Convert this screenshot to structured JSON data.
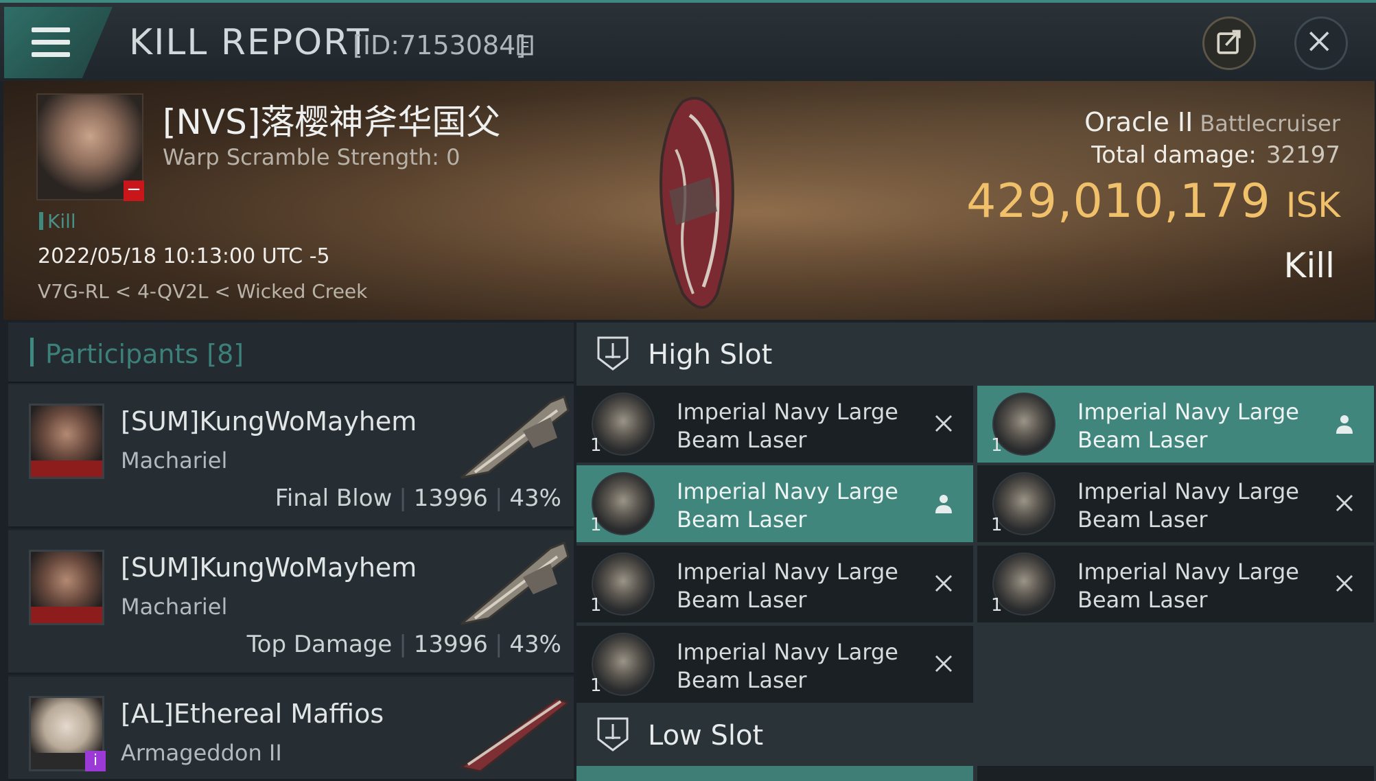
{
  "header": {
    "title": "KILL REPORT",
    "report_id": "[ID:7153084]"
  },
  "victim": {
    "name": "[NVS]落樱神斧华国父",
    "warp_scramble": "Warp Scramble Strength: 0",
    "tag": "Kill",
    "datetime": "2022/05/18 10:13:00 UTC -5",
    "location": "V7G-RL < 4-QV2L < Wicked Creek",
    "ship_name": "Oracle II",
    "ship_class": "Battlecruiser",
    "total_damage_label": "Total damage:",
    "total_damage": "32197",
    "isk_value": "429,010,179",
    "isk_unit": "ISK",
    "result": "Kill"
  },
  "participants": {
    "title": "Participants [8]",
    "items": [
      {
        "name": "[SUM]KungWoMayhem",
        "ship": "Machariel",
        "role": "Final Blow",
        "damage": "13996",
        "percent": "43%"
      },
      {
        "name": "[SUM]KungWoMayhem",
        "ship": "Machariel",
        "role": "Top Damage",
        "damage": "13996",
        "percent": "43%"
      },
      {
        "name": "[AL]Ethereal Maffios",
        "ship": "Armageddon II",
        "role": "",
        "damage": "",
        "percent": ""
      }
    ]
  },
  "slots": {
    "high_title": "High Slot",
    "low_title": "Low Slot",
    "high_modules": [
      {
        "name": "Imperial Navy Large Beam Laser",
        "qty": "1",
        "state": "destroyed",
        "icon": "close-icon"
      },
      {
        "name": "Imperial Navy Large Beam Laser",
        "qty": "1",
        "state": "dropped",
        "icon": "person-icon"
      },
      {
        "name": "Imperial Navy Large Beam Laser",
        "qty": "1",
        "state": "dropped",
        "icon": "person-icon"
      },
      {
        "name": "Imperial Navy Large Beam Laser",
        "qty": "1",
        "state": "destroyed",
        "icon": "close-icon"
      },
      {
        "name": "Imperial Navy Large Beam Laser",
        "qty": "1",
        "state": "destroyed",
        "icon": "close-icon"
      },
      {
        "name": "Imperial Navy Large Beam Laser",
        "qty": "1",
        "state": "destroyed",
        "icon": "close-icon"
      },
      {
        "name": "Imperial Navy Large Beam Laser",
        "qty": "1",
        "state": "destroyed",
        "icon": "close-icon"
      }
    ]
  },
  "colors": {
    "accent": "#3f8a80",
    "isk": "#f1c06a",
    "dropped_bg": "#41867d"
  }
}
